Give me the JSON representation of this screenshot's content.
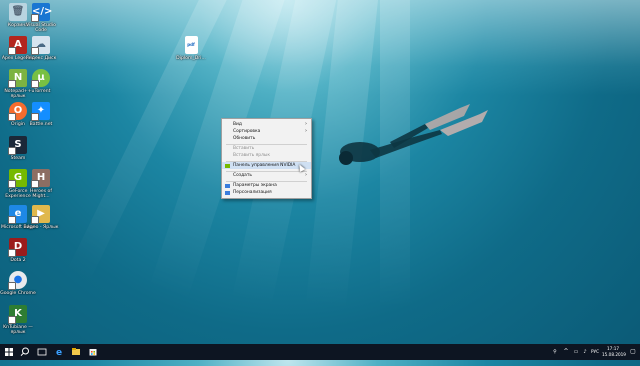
{
  "desktop": {
    "icons_left": [
      {
        "label": "Корзина",
        "icon": "recycle-bin-icon"
      },
      {
        "label": "Apex Legends",
        "icon": "apex-icon"
      },
      {
        "label": "Notepad++ ярлык",
        "icon": "notepad-icon"
      },
      {
        "label": "Origin",
        "icon": "origin-icon"
      },
      {
        "label": "Steam",
        "icon": "steam-icon"
      },
      {
        "label": "GeForce Experience",
        "icon": "geforce-icon"
      },
      {
        "label": "Microsoft Edge",
        "icon": "edge-icon"
      },
      {
        "label": "Dota 2",
        "icon": "dota-icon"
      },
      {
        "label": "Google Chrome",
        "icon": "chrome-icon"
      },
      {
        "label": "KnTubiane — ярлык",
        "icon": "app-shortcut-icon"
      }
    ],
    "icons_right": [
      {
        "label": "Visual Studio Code",
        "icon": "vscode-icon"
      },
      {
        "label": "Яндекс Диск",
        "icon": "yandex-disk-icon"
      },
      {
        "label": "uTorrent",
        "icon": "utorrent-icon"
      },
      {
        "label": "Battle.net",
        "icon": "battlenet-icon"
      },
      {
        "label": "Heroes of Might...",
        "icon": "heroes-icon"
      },
      {
        "label": "Видео - Ярлык",
        "icon": "video-folder-icon"
      }
    ],
    "file_icon": {
      "label": "Diplom_Dri...",
      "badge": "pdf"
    }
  },
  "context_menu": {
    "items": [
      {
        "label": "Вид",
        "submenu": true
      },
      {
        "label": "Сортировка",
        "submenu": true
      },
      {
        "label": "Обновить"
      },
      {
        "label": "Вставить",
        "disabled": true
      },
      {
        "label": "Вставить ярлык",
        "disabled": true
      },
      {
        "label": "Панель управления NVIDIA",
        "highlight": true
      },
      {
        "label": "Создать",
        "submenu": true
      },
      {
        "label": "Параметры экрана"
      },
      {
        "label": "Персонализация"
      }
    ]
  },
  "taskbar": {
    "lang": "РУС",
    "time": "17:17",
    "date": "15.08.2019"
  },
  "colors": {
    "taskbar": "#0d1522",
    "menu_bg": "#f2f2f2",
    "menu_hover": "#cfe0f3",
    "nvidia_green": "#76b900"
  }
}
